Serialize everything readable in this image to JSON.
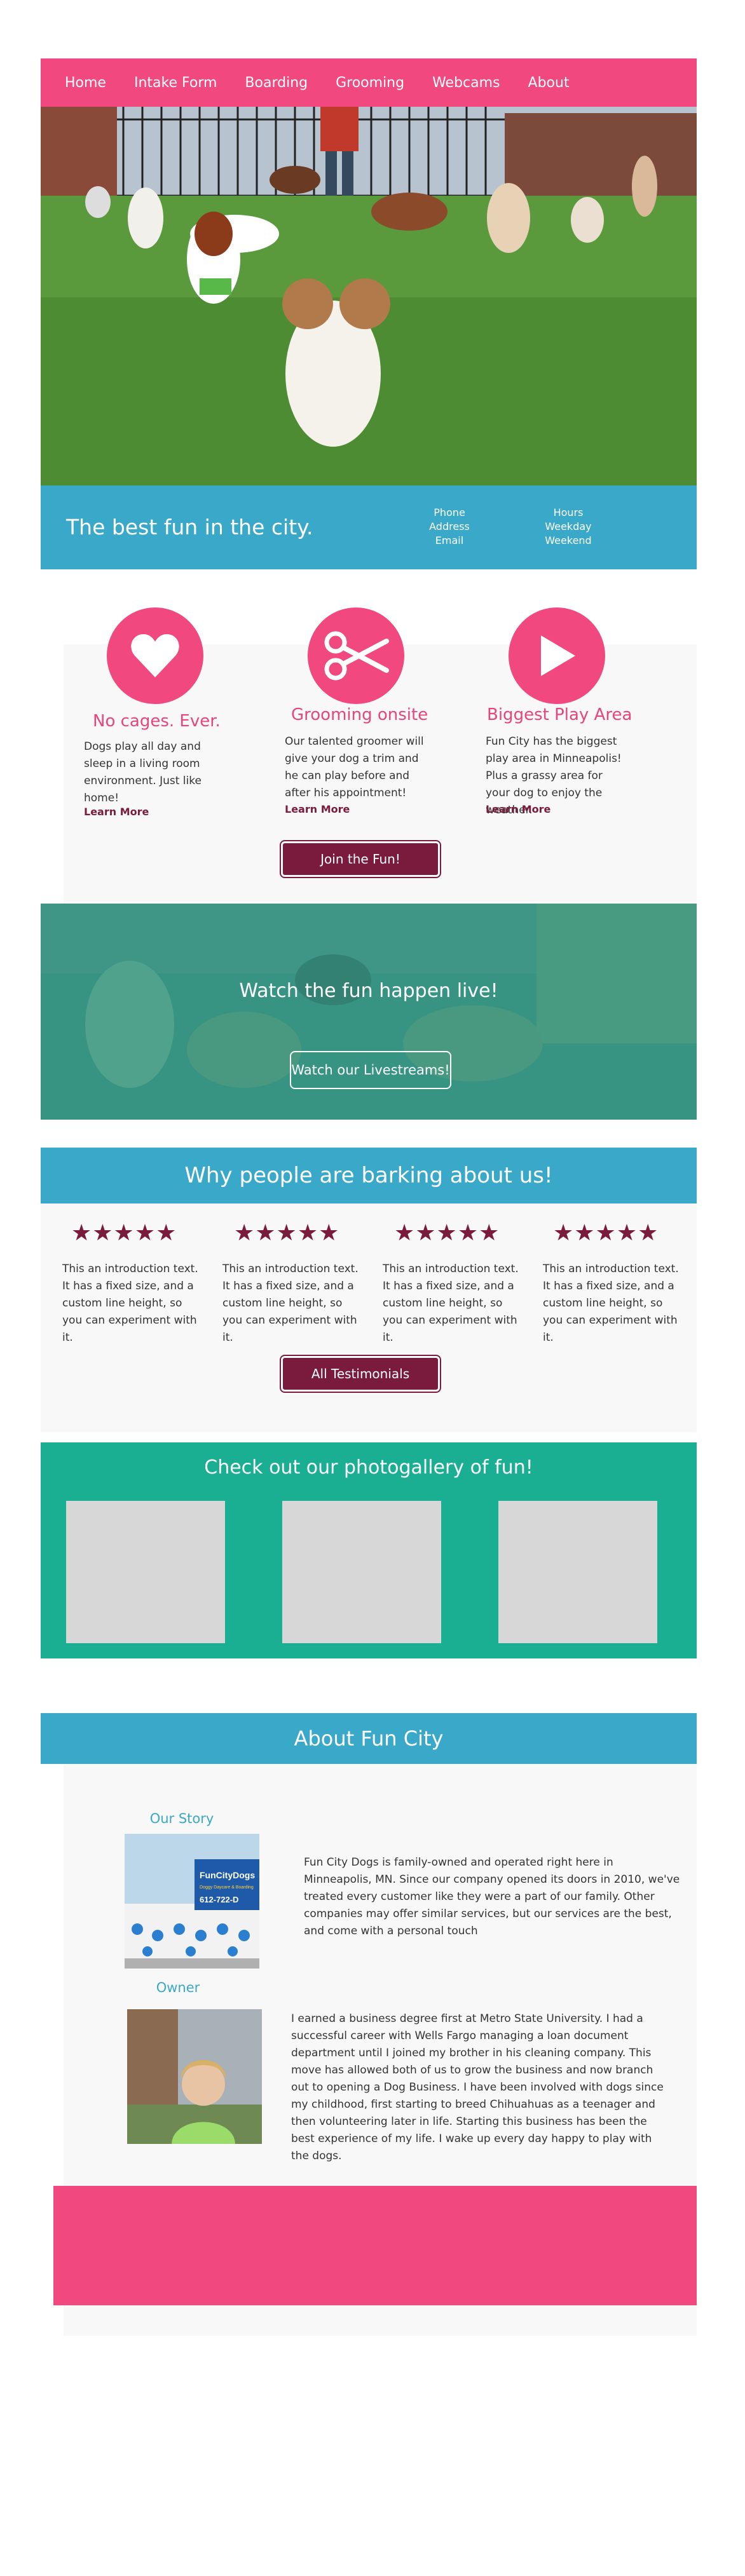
{
  "nav": {
    "items": [
      "Home",
      "Intake Form",
      "Boarding",
      "Grooming",
      "Webcams",
      "About"
    ]
  },
  "hero": {
    "tagline": "The best fun in the city.",
    "contact": [
      "Phone",
      "Address",
      "Email"
    ],
    "hours": [
      "Hours",
      "Weekday",
      "Weekend"
    ]
  },
  "features": [
    {
      "title": "No cages. Ever.",
      "text": "Dogs play all day and sleep in a living room environment.   Just like home!",
      "link": "Learn More",
      "icon": "heart-icon"
    },
    {
      "title": "Grooming onsite",
      "text": " Our talented groomer will give your dog a trim and he can play before and after his appointment!",
      "link": "Learn More",
      "icon": "scissors-icon"
    },
    {
      "title": "Biggest Play Area",
      "text": "Fun City has the biggest play area in Minneapolis! Plus a grassy area for your dog to enjoy the weather.",
      "link": "Learn More",
      "icon": "play-icon"
    }
  ],
  "join_button": "Join the Fun!",
  "livestream": {
    "heading": "Watch the fun happen live!",
    "button": "Watch our Livestreams!"
  },
  "testimonials": {
    "heading": "Why people are barking about us!",
    "stars": "★★★★★",
    "items": [
      "This an introduction text. It has a fixed size, and a custom line height, so you can experiment with it.",
      "This an introduction text. It has a fixed size, and a custom line height, so you can experiment with it.",
      "This an introduction text. It has a fixed size, and a custom line height, so you can experiment with it.",
      "This an introduction text. It has a fixed size, and a custom line height, so you can experiment with it."
    ],
    "button": "All Testimonials"
  },
  "gallery": {
    "heading": "Check out our photogallery of fun!"
  },
  "about": {
    "heading": "About Fun City",
    "story_label": "Our Story",
    "story_text": "Fun City Dogs is family-owned and operated right here in Minneapolis, MN. Since our company opened its doors in 2010, we've treated every customer like they were a part of our family. Other companies may offer similar services, but our services are the best, and come with a personal touch",
    "owner_label": "Owner",
    "owner_text": "I earned a business degree first at Metro State University.  I had a successful career with Wells Fargo managing a loan document department until I joined my brother in his cleaning company. This move has allowed both of us to grow the business and now branch out to opening a Dog Business. I have been involved with dogs since my childhood, first starting to breed Chihuahuas as a teenager and then volunteering later in life. Starting this business has been the best experience of my life. I wake up every day happy to play with the dogs.",
    "sign_text": "FunCityDogs",
    "sign_sub": "Doggy Daycare & Boarding",
    "sign_phone": "612-722-D"
  },
  "colors": {
    "pink": "#f0487f",
    "blue": "#3aa8c8",
    "teal": "#1aae93",
    "maroon": "#7a1b3e"
  }
}
